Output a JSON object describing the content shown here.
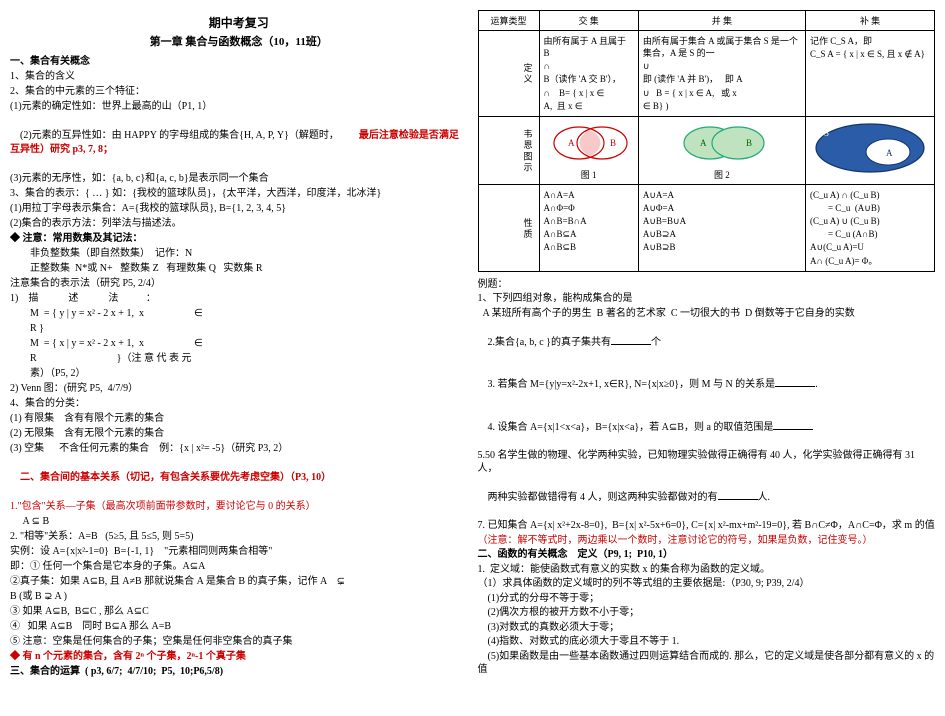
{
  "left": {
    "title": "期中考复习",
    "subtitle": "第一章 集合与函数概念（10，11班）",
    "h1": "一、集合有关概念",
    "l1": "1、集合的含义",
    "l2": "2、集合的中元素的三个特征：",
    "l2a": "(1)元素的确定性如：世界上最高的山（P1, 1）",
    "l2b": "(2)元素的互异性如：由 HAPPY 的字母组成的集合{H, A, P, Y}（解题时，",
    "l2b2": "        最后注意检验是否满足互异性）研究 p3, 7, 8；",
    "l2c": "(3)元素的无序性，如：{a, b, c}和{a, c, b}是表示同一个集合",
    "l3": "3、集合的表示：{ … } 如：{我校的篮球队员}，{太平洋，大西洋，印度洋，北冰洋}",
    "l3a": "(1)用拉丁字母表示集合：A={我校的篮球队员}, B={1, 2, 3, 4, 5}",
    "l3b": "(2)集合的表示方法：列举法与描述法。",
    "l4": "注意：常用数集及其记法：",
    "l4a": "        非负整数集（即自然数集）  记作：N",
    "l4b": "        正整数集  N*或 N+   整数集 Z   有理数集 Q   实数集 R",
    "l5": "注意集合的表示法（研究 P5, 2/4）",
    "l5a": "1)    描            述            法           ：",
    "l5b": "        M  = { y | y = x² - 2 x + 1,  x                    ∈",
    "l5c": "        R }",
    "l5d": "        M  = { x | y = x² - 2 x + 1,  x                    ∈",
    "l5e": "        R                                }（注 意 代 表 元",
    "l5f": "        素）（P5, 2）",
    "l5g": "2) Venn 图：(研究 P5,  4/7/9）",
    "l6": "4、集合的分类：",
    "l6a": "(1) 有限集    含有有限个元素的集合",
    "l6b": "(2) 无限集    含有无限个元素的集合",
    "l6c": "(3) 空集      不含任何元素的集合    例：{x | x²= -5}（研究 P3, 2）",
    "h2": "二、集合间的基本关系（切记，有包含关系要优先考虑空集）（P3, 10）",
    "l7a": "1.\"包含\"关系—子集（最高次项前面带参数时，要讨论它与 0 的关系）",
    "l7b": "     A ⊆ B",
    "l8a": "2. \"相等\"关系：A=B   (5≥5, 且 5≤5, 则 5=5)",
    "l8b": "实例：设 A={x|x²-1=0}  B={-1, 1}    \"元素相同则两集合相等\"",
    "l8c": "即：① 任何一个集合是它本身的子集。A⊆A",
    "l9": "②真子集：如果 A⊆B, 且 A≠B 那就说集合 A 是集合 B 的真子集，记作 A    ⊊",
    "l9b": "B (或 B ⊋ A )",
    "l9c": "③ 如果 A⊆B,  B⊆C , 那么 A⊆C",
    "l9d": "④   如果 A⊆B    同时 B⊆A 那么 A=B",
    "l9e": "⑤ 注意：空集是任何集合的子集；空集是任何非空集合的真子集",
    "l10": "有 n 个元素的集合，含有 2ⁿ 个子集，2ⁿ-1 个真子集",
    "h3": "三、集合的运算  ( p3, 6/7;  4/7/10;  P5,  10;P6,5/8)"
  },
  "table": {
    "h_op": "运算类型",
    "h_cap": "交    集",
    "h_cup": "并    集",
    "h_comp": "补    集",
    "r1": "定  义",
    "cap_def_1": "由所有属于 A 且属于 B",
    "cap_def_2": "∩",
    "cap_def_3": "B（读作 'A 交 B'），",
    "cap_def_4": "∩    B= { x | x ∈",
    "cap_def_5": "A,  且 x ∈",
    "cup_def_1": "由所有属于集合 A 或属于集合 S 是一个集合，A 是 S 的一",
    "cup_def_2": "∪",
    "cup_def_3": "即 (读作 'A 并 B')，   即 A",
    "cup_def_4": "∪   B = { x | x ∈ A,   或 x",
    "cup_def_5": "∈ B} )",
    "comp_def_1": "记作 C_S A，即",
    "comp_def_2": "C_S A = { x | x ∈ S, 且 x ∉ A}",
    "r2": "韦 恩 图 示",
    "fig1": "图 1",
    "fig2": "图 2",
    "r3": "性    质",
    "cap_p1": "A∩A=A",
    "cap_p2": "A∩Φ=Φ",
    "cap_p3": "A∩B=B∩A",
    "cap_p4": "A∩B⊆A",
    "cap_p5": "A∩B⊆B",
    "cup_p1": "A∪A=A",
    "cup_p2": "A∪Φ=A",
    "cup_p3": "A∪B=B∪A",
    "cup_p4": "A∪B⊇A",
    "cup_p5": "A∪B⊇B",
    "comp_p1": "(C_u A) ∩ (C_u B)",
    "comp_p2": "        = C_u  (A∪B)",
    "comp_p3": "(C_u A) ∪ (C_u B)",
    "comp_p4": "        = C_u (A∩B)",
    "comp_p5": "A∪(C_u A)=U",
    "comp_p6": "A∩ (C_u A)= Φ。"
  },
  "right": {
    "ex_h": "例题：",
    "q1": "1、下列四组对象，能构成集合的是",
    "q1o": "  A 某班所有高个子的男生  B 著名的艺术家  C 一切很大的书  D 倒数等于它自身的实数",
    "q2a": "2.集合{a, b, c }的真子集共有",
    "q2b": "个",
    "q3a": "3. 若集合 M={y|y=x²-2x+1, x∈R}, N={x|x≥0}，则 M 与 N 的关系是",
    "q3b": ".",
    "q4a": "4. 设集合 A=",
    "q4mid": "{x|1<x<a}，B={x|x<a}，若 A⊆B，则 a 的取值范围是",
    "q5": "5.50 名学生做的物理、化学两种实验，已知物理实验做得正确得有 40 人，化学实验做得正确得有 31 人，",
    "q5b": "两种实验都做错得有 4 人，则这两种实验都做对的有",
    "q5c": "人.",
    "q7a": "7. 已知集合 A={x| x²+2x-8=0},  B={x| x²-5x+6=0}, C={x| x²-mx+m²-19=0}, 若 B∩C≠Φ，A∩C=Φ，求 m 的值",
    "q7b": "（注意：解不等式时，两边乘以一个数时，注意讨论它的符号，如果是负数，记住变号。）",
    "r_h2": "二、函数的有关概念    定义（P9, 1;  P10, 1）",
    "r_l1": "1.  定义域：能使函数式有意义的实数 x 的集合称为函数的定义域。",
    "r_l2": "（1）求具体函数的定义域时的列不等式组的主要依据是:（P30, 9; P39, 2/4）",
    "r_l3": "    (1)分式的分母不等于零；",
    "r_l4": "    (2)偶次方根的被开方数不小于零；",
    "r_l5": "    (3)对数式的真数必须大于零；",
    "r_l6": "    (4)指数、对数式的底必须大于零且不等于 1.",
    "r_l7": "    (5)如果函数是由一些基本函数通过四则运算结合而成的. 那么，它的定义域是使各部分都有意义的 x 的值"
  }
}
